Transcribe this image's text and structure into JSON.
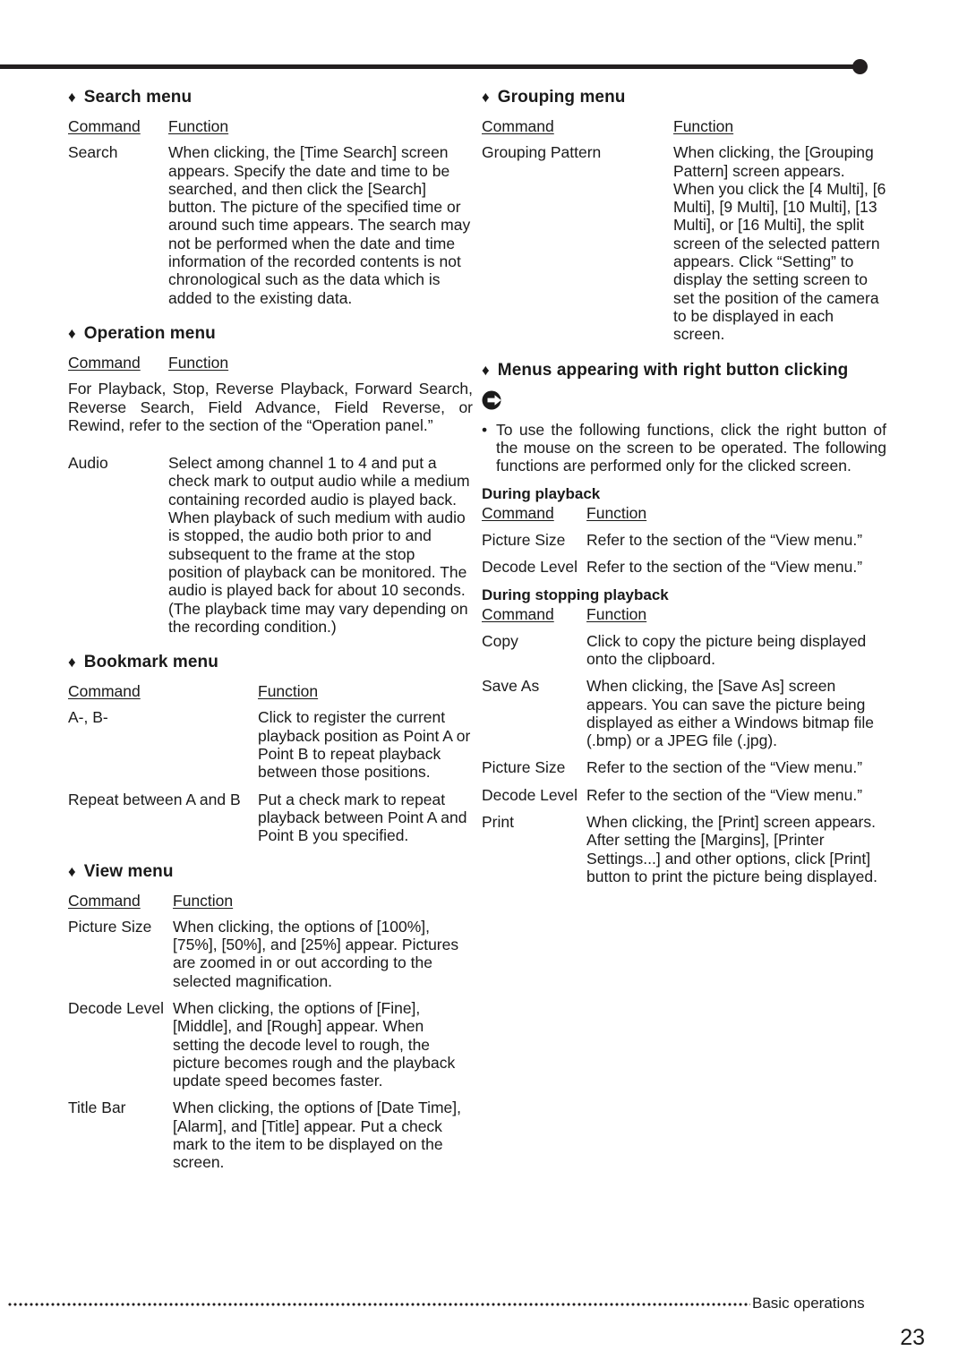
{
  "header": {
    "rule_icon": "header-rule-with-dot"
  },
  "footer": {
    "label": "Basic operations",
    "page_number": "23"
  },
  "table_headers": {
    "command": "Command",
    "function": "Function"
  },
  "left_column": {
    "search_menu": {
      "title": "Search menu",
      "bullet": "♦",
      "rows": [
        {
          "command": "Search",
          "function": "When clicking, the [Time Search] screen appears. Specify the date and time to be searched, and then click the [Search] button. The picture of the specified time or around such time appears. The search may not be performed when the date and time information of the recorded contents is not chronological such as the data which is added to the existing data."
        }
      ]
    },
    "operation_menu": {
      "title": "Operation menu",
      "bullet": "♦",
      "intro": "For Playback, Stop, Reverse Playback, Forward Search, Reverse Search, Field Advance, Field Reverse, or Rewind, refer to the section of the “Operation panel.”",
      "rows": [
        {
          "command": "Audio",
          "function": "Select among channel 1 to 4 and put a check mark to output audio while a medium containing recorded audio is played back. When playback of such medium with audio is stopped, the audio both prior to and subsequent to the frame at the stop position of playback can be monitored. The audio is played back for about 10 seconds. (The playback time may vary depending on the recording condition.)"
        }
      ]
    },
    "bookmark_menu": {
      "title": "Bookmark menu",
      "bullet": "♦",
      "rows": [
        {
          "command": "A-, B-",
          "function": "Click to register the current playback position as Point A or Point B to repeat playback between those positions."
        },
        {
          "command": "Repeat between A and B",
          "function": "Put a check mark to repeat playback between Point A and Point B you specified."
        }
      ]
    },
    "view_menu": {
      "title": "View menu",
      "bullet": "♦",
      "rows": [
        {
          "command": "Picture Size",
          "function": "When clicking, the options of [100%], [75%], [50%], and [25%] appear. Pictures are zoomed in or out according to the selected magnification."
        },
        {
          "command": "Decode Level",
          "function": "When clicking, the options of [Fine], [Middle], and [Rough] appear. When setting the decode level to rough, the picture becomes rough and the playback update speed becomes faster."
        },
        {
          "command": "Title Bar",
          "function": "When clicking, the options of [Date Time], [Alarm], and [Title] appear. Put a check mark to the item to be displayed on the screen."
        }
      ]
    }
  },
  "right_column": {
    "grouping_menu": {
      "title": "Grouping menu",
      "bullet": "♦",
      "rows": [
        {
          "command": "Grouping Pattern",
          "function": "When clicking, the [Grouping Pattern] screen appears. When you click the [4 Multi], [6 Multi], [9 Multi], [10 Multi], [13 Multi], or [16 Multi], the split screen of the selected pattern appears. Click “Setting” to display the setting screen to set the position of the camera to be displayed in each screen."
        }
      ]
    },
    "right_click_menus": {
      "title": "Menus appearing with right button clicking",
      "bullet": "♦",
      "note_bullet": "•",
      "note": "To use the following functions, click the right button of the mouse on the screen to be operated. The following functions are performed only for the clicked screen.",
      "during_playback": {
        "heading": "During playback",
        "rows": [
          {
            "command": "Picture Size",
            "function": "Refer to the section of the “View menu.”"
          },
          {
            "command": "Decode Level",
            "function": "Refer to the section of the “View menu.”"
          }
        ]
      },
      "during_stopping_playback": {
        "heading": "During stopping playback",
        "rows": [
          {
            "command": "Copy",
            "function": "Click to copy the picture being displayed onto the clipboard."
          },
          {
            "command": "Save As",
            "function": "When clicking, the [Save As] screen appears. You can save the picture being displayed as either a Windows bitmap file (.bmp) or a JPEG file (.jpg)."
          },
          {
            "command": "Picture Size",
            "function": "Refer to the section of the “View menu.”"
          },
          {
            "command": "Decode Level",
            "function": "Refer to the section of the “View menu.”"
          },
          {
            "command": "Print",
            "function": "When clicking, the [Print] screen appears. After setting the [Margins], [Printer Settings...] and other options, click [Print] button to print the picture being displayed."
          }
        ]
      }
    }
  }
}
